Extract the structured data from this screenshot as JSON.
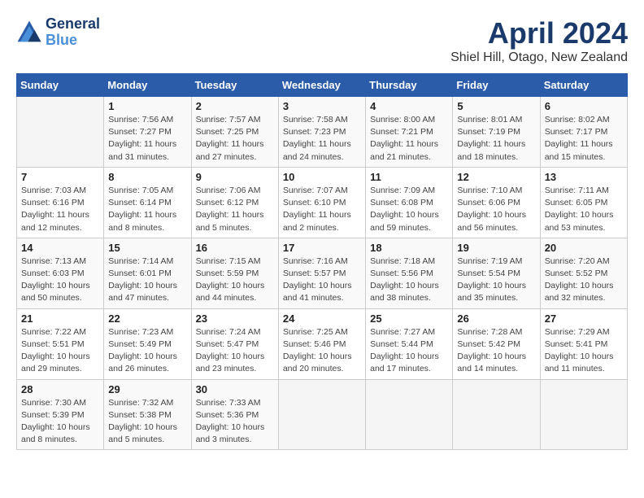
{
  "header": {
    "logo_line1": "General",
    "logo_line2": "Blue",
    "title": "April 2024",
    "subtitle": "Shiel Hill, Otago, New Zealand"
  },
  "days_of_week": [
    "Sunday",
    "Monday",
    "Tuesday",
    "Wednesday",
    "Thursday",
    "Friday",
    "Saturday"
  ],
  "weeks": [
    [
      {
        "day": "",
        "info": ""
      },
      {
        "day": "1",
        "info": "Sunrise: 7:56 AM\nSunset: 7:27 PM\nDaylight: 11 hours\nand 31 minutes."
      },
      {
        "day": "2",
        "info": "Sunrise: 7:57 AM\nSunset: 7:25 PM\nDaylight: 11 hours\nand 27 minutes."
      },
      {
        "day": "3",
        "info": "Sunrise: 7:58 AM\nSunset: 7:23 PM\nDaylight: 11 hours\nand 24 minutes."
      },
      {
        "day": "4",
        "info": "Sunrise: 8:00 AM\nSunset: 7:21 PM\nDaylight: 11 hours\nand 21 minutes."
      },
      {
        "day": "5",
        "info": "Sunrise: 8:01 AM\nSunset: 7:19 PM\nDaylight: 11 hours\nand 18 minutes."
      },
      {
        "day": "6",
        "info": "Sunrise: 8:02 AM\nSunset: 7:17 PM\nDaylight: 11 hours\nand 15 minutes."
      }
    ],
    [
      {
        "day": "7",
        "info": "Sunrise: 7:03 AM\nSunset: 6:16 PM\nDaylight: 11 hours\nand 12 minutes."
      },
      {
        "day": "8",
        "info": "Sunrise: 7:05 AM\nSunset: 6:14 PM\nDaylight: 11 hours\nand 8 minutes."
      },
      {
        "day": "9",
        "info": "Sunrise: 7:06 AM\nSunset: 6:12 PM\nDaylight: 11 hours\nand 5 minutes."
      },
      {
        "day": "10",
        "info": "Sunrise: 7:07 AM\nSunset: 6:10 PM\nDaylight: 11 hours\nand 2 minutes."
      },
      {
        "day": "11",
        "info": "Sunrise: 7:09 AM\nSunset: 6:08 PM\nDaylight: 10 hours\nand 59 minutes."
      },
      {
        "day": "12",
        "info": "Sunrise: 7:10 AM\nSunset: 6:06 PM\nDaylight: 10 hours\nand 56 minutes."
      },
      {
        "day": "13",
        "info": "Sunrise: 7:11 AM\nSunset: 6:05 PM\nDaylight: 10 hours\nand 53 minutes."
      }
    ],
    [
      {
        "day": "14",
        "info": "Sunrise: 7:13 AM\nSunset: 6:03 PM\nDaylight: 10 hours\nand 50 minutes."
      },
      {
        "day": "15",
        "info": "Sunrise: 7:14 AM\nSunset: 6:01 PM\nDaylight: 10 hours\nand 47 minutes."
      },
      {
        "day": "16",
        "info": "Sunrise: 7:15 AM\nSunset: 5:59 PM\nDaylight: 10 hours\nand 44 minutes."
      },
      {
        "day": "17",
        "info": "Sunrise: 7:16 AM\nSunset: 5:57 PM\nDaylight: 10 hours\nand 41 minutes."
      },
      {
        "day": "18",
        "info": "Sunrise: 7:18 AM\nSunset: 5:56 PM\nDaylight: 10 hours\nand 38 minutes."
      },
      {
        "day": "19",
        "info": "Sunrise: 7:19 AM\nSunset: 5:54 PM\nDaylight: 10 hours\nand 35 minutes."
      },
      {
        "day": "20",
        "info": "Sunrise: 7:20 AM\nSunset: 5:52 PM\nDaylight: 10 hours\nand 32 minutes."
      }
    ],
    [
      {
        "day": "21",
        "info": "Sunrise: 7:22 AM\nSunset: 5:51 PM\nDaylight: 10 hours\nand 29 minutes."
      },
      {
        "day": "22",
        "info": "Sunrise: 7:23 AM\nSunset: 5:49 PM\nDaylight: 10 hours\nand 26 minutes."
      },
      {
        "day": "23",
        "info": "Sunrise: 7:24 AM\nSunset: 5:47 PM\nDaylight: 10 hours\nand 23 minutes."
      },
      {
        "day": "24",
        "info": "Sunrise: 7:25 AM\nSunset: 5:46 PM\nDaylight: 10 hours\nand 20 minutes."
      },
      {
        "day": "25",
        "info": "Sunrise: 7:27 AM\nSunset: 5:44 PM\nDaylight: 10 hours\nand 17 minutes."
      },
      {
        "day": "26",
        "info": "Sunrise: 7:28 AM\nSunset: 5:42 PM\nDaylight: 10 hours\nand 14 minutes."
      },
      {
        "day": "27",
        "info": "Sunrise: 7:29 AM\nSunset: 5:41 PM\nDaylight: 10 hours\nand 11 minutes."
      }
    ],
    [
      {
        "day": "28",
        "info": "Sunrise: 7:30 AM\nSunset: 5:39 PM\nDaylight: 10 hours\nand 8 minutes."
      },
      {
        "day": "29",
        "info": "Sunrise: 7:32 AM\nSunset: 5:38 PM\nDaylight: 10 hours\nand 5 minutes."
      },
      {
        "day": "30",
        "info": "Sunrise: 7:33 AM\nSunset: 5:36 PM\nDaylight: 10 hours\nand 3 minutes."
      },
      {
        "day": "",
        "info": ""
      },
      {
        "day": "",
        "info": ""
      },
      {
        "day": "",
        "info": ""
      },
      {
        "day": "",
        "info": ""
      }
    ]
  ]
}
